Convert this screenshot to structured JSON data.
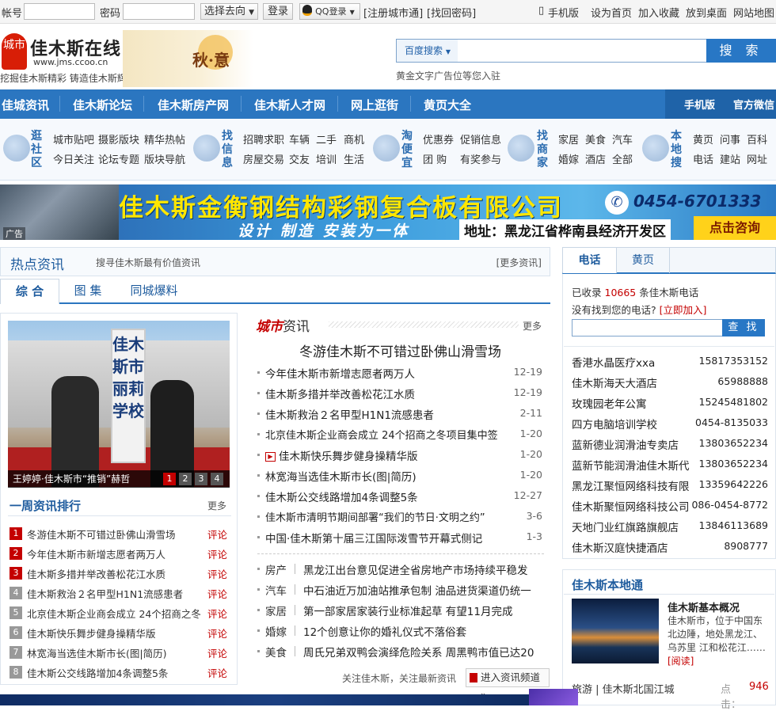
{
  "topbar": {
    "account_label": "帐号",
    "password_label": "密码",
    "goto_select": "选择去向",
    "login_btn": "登录",
    "qq_login": "QQ登录",
    "register": "[注册城市通]",
    "find_pwd": "[找回密码]",
    "mobile": "手机版",
    "set_home": "设为首页",
    "favorite": "加入收藏",
    "to_desktop": "放到桌面",
    "sitemap": "网站地图"
  },
  "header": {
    "logo_badge": "城市",
    "logo_title": "佳木斯在线",
    "logo_url": "www.jms.ccoo.cn",
    "slogan": "挖掘佳木斯精彩 铸造佳木斯辉煌",
    "autumn_text": "秋·意",
    "search_select": "百度搜索",
    "search_button": "搜 索",
    "ad_text": "黄金文字广告位等您入驻"
  },
  "nav": {
    "items": [
      "佳城资讯",
      "佳木斯论坛",
      "佳木斯房产网",
      "佳木斯人才网",
      "网上逛街",
      "黄页大全"
    ],
    "right": [
      "手机版",
      "官方微信"
    ]
  },
  "subnav": {
    "groups": [
      {
        "title": "逛社区",
        "links": [
          "城市贴吧",
          "摄影版块",
          "精华热帖",
          "今日关注",
          "论坛专题",
          "版块导航"
        ]
      },
      {
        "title": "找信息",
        "links": [
          "招聘求职",
          "车辆",
          "二手",
          "商机",
          "房屋交易",
          "交友",
          "培训",
          "生活"
        ]
      },
      {
        "title": "淘便宜",
        "links": [
          "优惠券",
          "促销信息",
          "团 购",
          "有奖参与"
        ]
      },
      {
        "title": "找商家",
        "links": [
          "家居",
          "美食",
          "汽车",
          "婚嫁",
          "酒店",
          "全部"
        ]
      },
      {
        "title": "本地搜",
        "links": [
          "黄页",
          "问事",
          "百科",
          "电话",
          "建站",
          "网址"
        ]
      }
    ]
  },
  "banner": {
    "title": "佳木斯金衡钢结构彩钢复合板有限公司",
    "phone": "0454-6701333",
    "subtitle": "设计 制造 安装为一体",
    "address": "地址：黑龙江省桦南县经济开发区",
    "cta": "点击咨询",
    "ad_label": "广告"
  },
  "hot": {
    "title": "热点资讯",
    "desc": "搜寻佳木斯最有价值资讯",
    "more": "[更多资讯]",
    "tabs": [
      "综 合",
      "图 集",
      "同城爆料"
    ]
  },
  "photo": {
    "sign_text": "佳木斯市丽莉学校",
    "caption": "王婷婷·佳木斯市“推销”赫哲",
    "pages": [
      "1",
      "2",
      "3",
      "4"
    ]
  },
  "rank": {
    "title": "一周资讯排行",
    "more": "更多",
    "comment": "评论",
    "items": [
      "冬游佳木斯不可错过卧佛山滑雪场",
      "今年佳木斯市新增志愿者两万人",
      "佳木斯多措并举改善松花江水质",
      "佳木斯救治２名甲型H1N1流感患者",
      "北京佳木斯企业商会成立 24个招商之冬",
      "佳木斯快乐舞步健身操精华版",
      "林宽海当选佳木斯市长(图|简历)",
      "佳木斯公交线路增加4条调整5条"
    ]
  },
  "city": {
    "title_red": "城市",
    "title_rest": "资讯",
    "more": "更多",
    "headline": "冬游佳木斯不可错过卧佛山滑雪场",
    "news": [
      {
        "t": "今年佳木斯市新增志愿者两万人",
        "d": "12-19"
      },
      {
        "t": "佳木斯多措并举改善松花江水质",
        "d": "12-19"
      },
      {
        "t": "佳木斯救治２名甲型H1N1流感患者",
        "d": "2-11"
      },
      {
        "t": "北京佳木斯企业商会成立 24个招商之冬项目集中签",
        "d": "1-20"
      },
      {
        "t": "佳木斯快乐舞步健身操精华版",
        "d": "1-20"
      },
      {
        "t": "林宽海当选佳木斯市长(图|简历)",
        "d": "1-20"
      },
      {
        "t": "佳木斯公交线路增加4条调整5条",
        "d": "12-27"
      },
      {
        "t": "佳木斯市清明节期间部署“我们的节日·文明之约”",
        "d": "3-6"
      },
      {
        "t": "中国·佳木斯第十届三江国际泼雪节开幕式侧记",
        "d": "1-3"
      }
    ],
    "categories": [
      {
        "k": "房产",
        "t": "黑龙江出台意见促进全省房地产市场持续平稳发"
      },
      {
        "k": "汽车",
        "t": "中石油近万加油站推承包制 油品进货渠道仍统一"
      },
      {
        "k": "家居",
        "t": "第一部家居家装行业标准起草 有望11月完成"
      },
      {
        "k": "婚嫁",
        "t": "12个创意让你的婚礼仪式不落俗套"
      },
      {
        "k": "美食",
        "t": "周氏兄弟双鸭会演绎危险关系 周黑鸭市值已达20"
      }
    ],
    "follow_text": "关注佳木斯，关注最新资讯",
    "enter_channel": "进入资讯频道 »"
  },
  "phonebook": {
    "tabs": [
      "电话",
      "黄页"
    ],
    "collected_pre": "已收录",
    "collected_count": "10665",
    "collected_post": "条佳木斯电话",
    "not_found": "没有找到您的电话?",
    "join": "[立即加入]",
    "search_btn": "查 找",
    "entries": [
      {
        "n": "香港水晶医疗xxa",
        "p": "15817353152"
      },
      {
        "n": "佳木斯海天大酒店",
        "p": "65988888"
      },
      {
        "n": "玫瑰园老年公寓",
        "p": "15245481802"
      },
      {
        "n": "四方电脑培训学校",
        "p": "0454-8135033"
      },
      {
        "n": "蓝新德业润滑油专卖店",
        "p": "13803652234"
      },
      {
        "n": "蓝新节能润滑油佳木斯代",
        "p": "13803652234"
      },
      {
        "n": "黑龙江聚恒网络科技有限",
        "p": "13359642226"
      },
      {
        "n": "佳木斯聚恒网络科技公司",
        "p": "086-0454-8772"
      },
      {
        "n": "天地门业红旗路旗舰店",
        "p": "13846113689"
      },
      {
        "n": "佳木斯汉庭快捷酒店",
        "p": "8908777"
      }
    ]
  },
  "localmap": {
    "title": "佳木斯本地通",
    "item_title": "佳木斯基本概况",
    "item_desc": "佳木斯市，位于中国东北边陲，地处黑龙江、乌苏里 江和松花江……",
    "read": "[阅读]",
    "next_cat": "旅游",
    "next_title": "佳木斯北国江城",
    "next_click": "点击：",
    "next_count": "946"
  }
}
